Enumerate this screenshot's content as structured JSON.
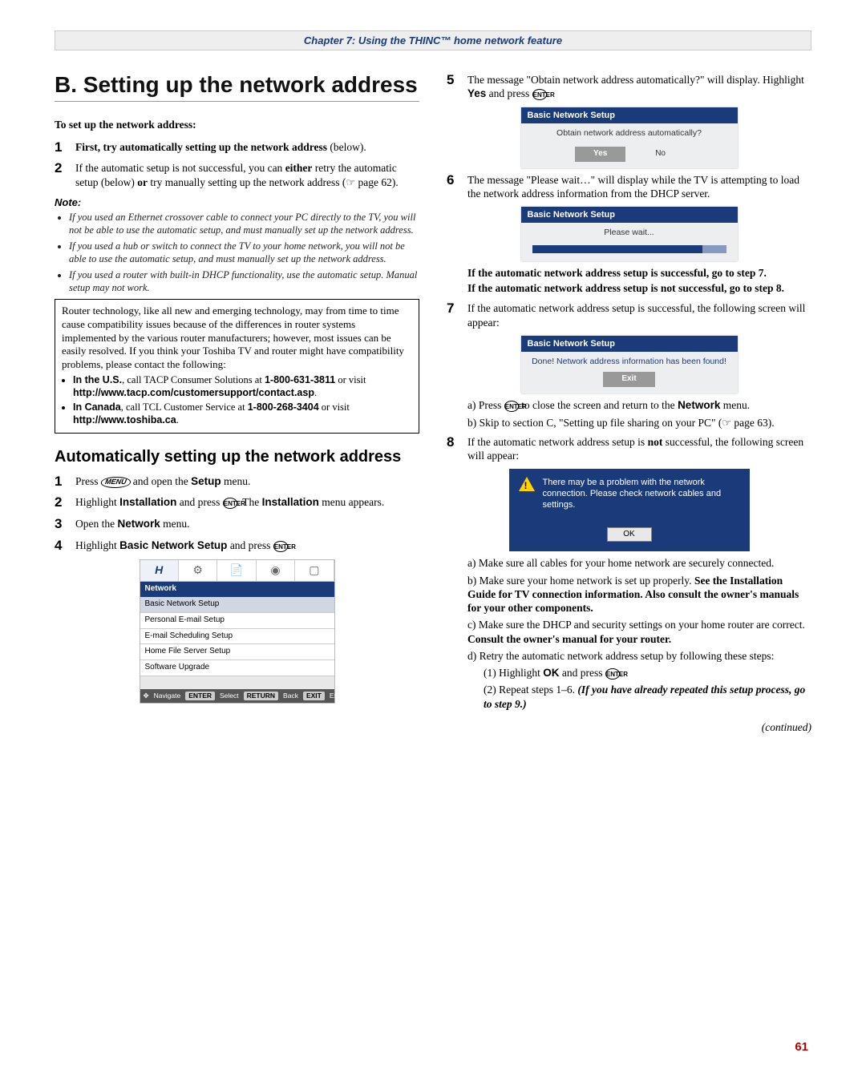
{
  "chapter_bar": "Chapter 7: Using the THINC™ home network feature",
  "left": {
    "h1": "B. Setting up the network address",
    "lead": "To set up the network address:",
    "step1": {
      "num": "1",
      "body": "First, try automatically setting up the network address (below).",
      "bold_body": "First, try automatically setting up the network address"
    },
    "step2": {
      "num": "2",
      "pre": "If the automatic setup is not successful, you can ",
      "either": "either",
      "mid": " retry the automatic setup (below) ",
      "or": "or",
      "post": " try manually setting up the network address (",
      "ref": " page 62)."
    },
    "note_head": "Note:",
    "notes": [
      "If you used an Ethernet crossover cable to connect your PC directly to the TV, you will not be able to use the automatic setup, and must manually set up the network address.",
      "If you used a hub or switch to connect the TV to your home network, you will not be able to use the automatic setup, and must manually set up the network address.",
      "If you used a router with built-in DHCP functionality, use the automatic setup. Manual setup may not work."
    ],
    "router_intro": "Router technology, like all new and emerging technology, may from time to time cause compatibility issues because of the differences in router systems implemented by the various router manufacturers; however, most issues can be easily resolved. If you think your Toshiba TV and router might have compatibility problems, please contact the following:",
    "router_us_pre": "In the U.S.",
    "router_us_body": ", call TACP Consumer Solutions at ",
    "router_us_phone": "1-800-631-3811",
    "router_us_or": " or visit ",
    "router_us_url": "http://www.tacp.com/customersupport/contact.asp",
    "router_ca_pre": "In Canada",
    "router_ca_body": ", call TCL Customer Service at ",
    "router_ca_phone": "1-800-268-3404",
    "router_ca_or": " or visit ",
    "router_ca_url": "http://www.toshiba.ca",
    "h2": "Automatically setting up the network address",
    "astep1": {
      "num": "1",
      "pre": "Press ",
      "menu": "MENU",
      "post": " and open the ",
      "setup": "Setup",
      "post2": " menu."
    },
    "astep2": {
      "num": "2",
      "pre": "Highlight ",
      "inst": "Installation",
      "mid": " and press ",
      "enter": "ENTER",
      "post": ". The ",
      "inst2": "Installation",
      "post2": " menu appears."
    },
    "astep3": {
      "num": "3",
      "pre": "Open the ",
      "net": "Network",
      "post": " menu."
    },
    "astep4": {
      "num": "4",
      "pre": "Highlight ",
      "bns": "Basic Network Setup",
      "post": " and press ",
      "enter": "ENTER",
      "post2": "."
    },
    "netmenu": {
      "title": "Network",
      "items": [
        "Basic Network Setup",
        "Personal E-mail Setup",
        "E-mail Scheduling Setup",
        "Home File Server Setup",
        "Software Upgrade"
      ],
      "foot_nav": "Navigate",
      "foot_sel": "Select",
      "foot_back": "Back",
      "foot_exit": "Exit",
      "pill_enter": "ENTER",
      "pill_rtn": "RETURN",
      "pill_exit": "EXIT"
    }
  },
  "right": {
    "step5": {
      "num": "5",
      "pre": "The message \"Obtain network address automatically?\" will display. Highlight ",
      "yes": "Yes",
      "post": " and press ",
      "enter": "ENTER",
      "post2": "."
    },
    "dlg1": {
      "title": "Basic Network Setup",
      "prompt": "Obtain network address automatically?",
      "yes": "Yes",
      "no": "No"
    },
    "step6": {
      "num": "6",
      "body": "The message \"Please wait…\" will display while the TV is attempting to load the network address information from the DHCP server."
    },
    "dlg2": {
      "title": "Basic Network Setup",
      "wait": "Please wait..."
    },
    "after6_a": "If the automatic network address setup is successful, go to step 7.",
    "after6_b": "If the automatic network address setup is not successful, go to step 8.",
    "step7": {
      "num": "7",
      "body": "If the automatic network address setup is successful, the following screen will appear:"
    },
    "dlg3": {
      "title": "Basic Network Setup",
      "done": "Done! Network address information has been found!",
      "exit": "Exit"
    },
    "s7a_pre": "a) Press ",
    "s7a_enter": "ENTER",
    "s7a_mid": " to close the screen and return to the ",
    "s7a_net": "Network",
    "s7a_post": " menu.",
    "s7b_pre": "b) Skip to section C, \"Setting up file sharing on your PC\" (",
    "s7b_ref": " page 63).",
    "step8": {
      "num": "8",
      "pre": "If the automatic network address setup is ",
      "not": "not",
      "post": " successful, the following screen will appear:"
    },
    "dlg4": {
      "msg": "There may be a problem with the network connection. Please check network cables and settings.",
      "ok": "OK"
    },
    "s8a": "a) Make sure all cables for your home network are securely connected.",
    "s8b_pre": "b) Make sure your home network is set up properly. ",
    "s8b_bold": "See the Installation Guide for TV connection information. Also consult the owner's manuals for your other components.",
    "s8c_pre": "c) Make sure the DHCP and security settings on your home router are correct. ",
    "s8c_bold": "Consult the owner's manual for your router.",
    "s8d": "d) Retry the automatic network address setup by following these steps:",
    "s8d1_pre": "(1) Highlight ",
    "s8d1_ok": "OK",
    "s8d1_mid": " and press ",
    "s8d1_enter": "ENTER",
    "s8d1_post": ".",
    "s8d2_pre": "(2) Repeat steps 1–6. ",
    "s8d2_ital": "(If you have already repeated this setup process, go to step 9.)"
  },
  "continued": "(continued)",
  "page_num": "61"
}
